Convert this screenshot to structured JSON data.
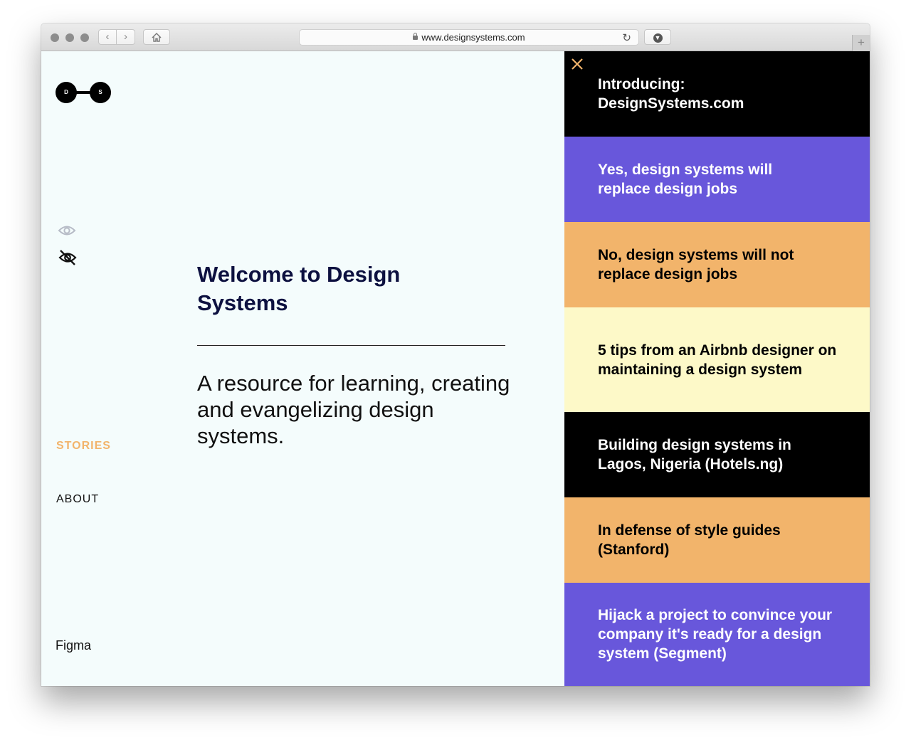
{
  "browser": {
    "url": "www.designsystems.com",
    "back_icon": "chevron-left-icon",
    "forward_icon": "chevron-right-icon",
    "home_icon": "home-icon",
    "reload_icon": "reload-icon",
    "download_icon": "download-icon",
    "new_tab_label": "+"
  },
  "logo": {
    "left_letter": "D",
    "right_letter": "S"
  },
  "sidebar": {
    "icons": [
      "eye-icon",
      "eye-slash-icon"
    ],
    "nav": [
      {
        "label": "STORIES",
        "active": true,
        "color": "#f2b46b"
      },
      {
        "label": "ABOUT",
        "active": false
      }
    ],
    "footer_label": "Figma"
  },
  "hero": {
    "title": "Welcome to Design Systems",
    "subtitle": "A resource for learning, creating and evangelizing design systems."
  },
  "stories": {
    "close_icon": "close-icon",
    "close_color": "#f2b46b",
    "items": [
      {
        "title": "Introducing: DesignSystems.com",
        "bg": "#000000",
        "fg": "#ffffff"
      },
      {
        "title": "Yes, design systems will replace design jobs",
        "bg": "#6857db",
        "fg": "#ffffff"
      },
      {
        "title": "No, design systems will not replace design jobs",
        "bg": "#f2b46b",
        "fg": "#000000"
      },
      {
        "title": "5 tips from an Airbnb designer on maintaining a design system",
        "bg": "#fdf9c8",
        "fg": "#000000"
      },
      {
        "title": "Building design systems in Lagos, Nigeria (Hotels.ng)",
        "bg": "#000000",
        "fg": "#ffffff"
      },
      {
        "title": "In defense of style guides (Stanford)",
        "bg": "#f2b46b",
        "fg": "#000000"
      },
      {
        "title": "Hijack a project to convince your company it's ready for a design system (Segment)",
        "bg": "#6857db",
        "fg": "#ffffff"
      }
    ]
  }
}
